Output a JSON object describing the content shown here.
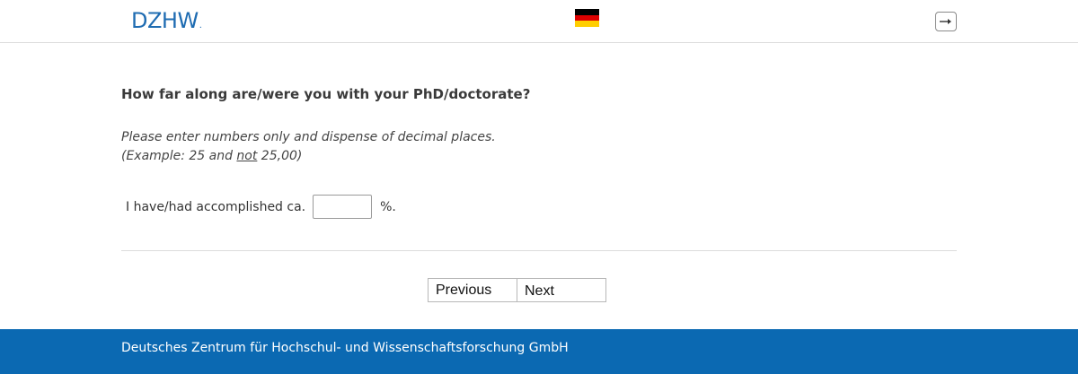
{
  "header": {
    "logo_text": "DZHW",
    "logo_dot": ".",
    "flag_colors": [
      "#000000",
      "#dd0000",
      "#ffce00"
    ],
    "logout_icon": "logout-icon"
  },
  "question": {
    "title": "How far along are/were you with your PhD/doctorate?",
    "hint_line1": "Please enter numbers only and dispense of decimal places.",
    "hint_line2_pre": "(Example: 25 and ",
    "hint_line2_not": "not",
    "hint_line2_post": " 25,00)",
    "answer_prefix": "I have/had accomplished ca.",
    "answer_value": "",
    "answer_suffix": "%."
  },
  "nav": {
    "previous_label": "Previous",
    "next_label": "Next"
  },
  "footer": {
    "text": "Deutsches Zentrum für Hochschul- und Wissenschaftsforschung GmbH",
    "color": "#0b69b2"
  }
}
